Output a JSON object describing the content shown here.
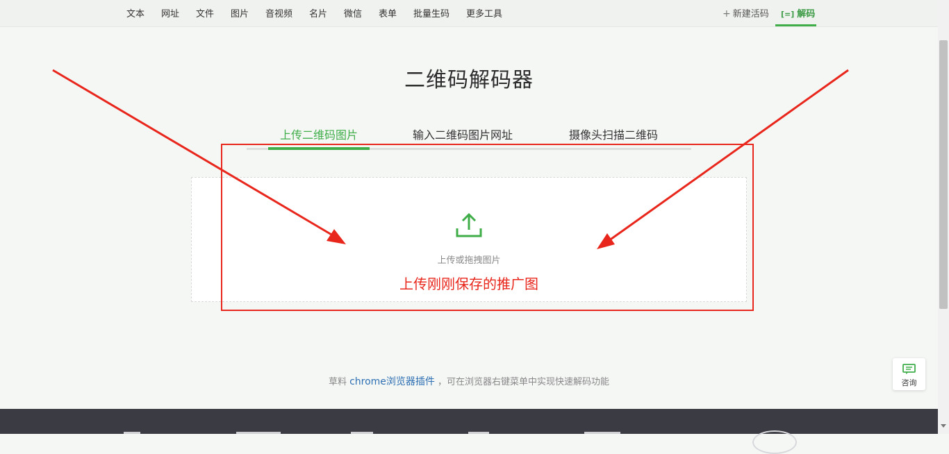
{
  "nav": {
    "items": [
      "文本",
      "网址",
      "文件",
      "图片",
      "音视频",
      "名片",
      "微信",
      "表单",
      "批量生码",
      "更多工具"
    ],
    "new_code": "新建活码",
    "decode": "解码"
  },
  "page": {
    "title": "二维码解码器"
  },
  "tabs": [
    "上传二维码图片",
    "输入二维码图片网址",
    "摄像头扫描二维码"
  ],
  "dropzone": {
    "hint": "上传或拖拽图片",
    "annotation": "上传刚刚保存的推广图"
  },
  "plugin_note": {
    "prefix": "草料 ",
    "link": "chrome浏览器插件",
    "suffix": " ，可在浏览器右键菜单中实现快速解码功能"
  },
  "consult": {
    "label": "咨询"
  },
  "colors": {
    "accent": "#3fae49",
    "annotation_red": "#e8261b",
    "link": "#2d6fb2"
  },
  "icons": [
    "plus-icon",
    "scan-icon",
    "upload-icon",
    "chat-icon"
  ]
}
